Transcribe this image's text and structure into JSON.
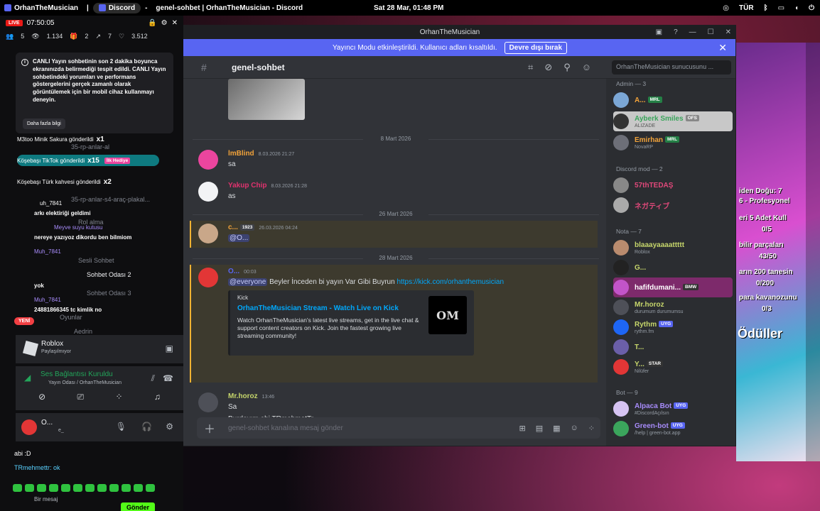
{
  "os": {
    "app1": "OrhanTheMusician",
    "app2": "Discord",
    "window_title": "genel-sohbet | OrhanTheMusician - Discord",
    "datetime": "Sat 28 Mar, 01:48 PM",
    "lang": "TÜR"
  },
  "stream": {
    "live": "LIVE",
    "timer": "07:50:05",
    "stats": [
      "5",
      "1.134",
      "2",
      "7",
      "3.512"
    ],
    "warning": "CANLI Yayın sohbetinin son 2 dakika boyunca ekranınızda belirmediği tespit edildi. CANLI Yayın sohbetindeki yorumları ve performans göstergelerini gerçek zamanlı olarak görüntülemek için bir mobil cihaz kullanmayı deneyin.",
    "warning_more": "Daha fazla bilgi",
    "gifts": [
      {
        "text": "M3too Minik Sakura gönderildi",
        "count": "x1"
      },
      {
        "text": "Köşebaşı TikTok gönderildi",
        "count": "x15",
        "badge": "İlk Hediye"
      },
      {
        "text": "Köşebaşı Türk kahvesi gönderildi",
        "count": "x2"
      }
    ],
    "chat": [
      "uh_7841",
      "arkı elektiriği geldimi",
      "Meyve suyu kutusu",
      "nereye yazıyoz dikordu ben bilmiom",
      "Muh_7841",
      "yok",
      "Muh_7841",
      "24881866345 tc kimlik no"
    ],
    "bottom_chat": [
      "abi :D",
      "TRmehmettr: ok"
    ],
    "input_placeholder": "Bir mesaj",
    "send": "Gönder",
    "new_badge": "YENİ"
  },
  "sidebar": {
    "channels": [
      "35-rp-anlar-al",
      "35-rp-anlar-s4-araç-plakal...",
      "Rol alma",
      "Sesli Sohbet",
      "Sohbet Odası 2",
      "Sohbet Odası 3",
      "Oyunlar",
      "Aedrin"
    ],
    "activity_name": "Roblox",
    "activity_sub": "Paylaşılmıyor",
    "voice_status": "Ses Bağlantısı Kuruldu",
    "voice_channel": "Yayın Odası / OrhanTheMusician",
    "user_name": "O...",
    "user_sub": "e_"
  },
  "discord": {
    "title": "OrhanTheMusician",
    "banner_text": "Yayıncı Modu etkinleştirildi. Kullanıcı adları kısaltıldı.",
    "banner_btn": "Devre dışı bırak",
    "channel": "genel-sohbet",
    "search_placeholder": "OrhanTheMusician sunucusunu ...",
    "composer_placeholder": "genel-sohbet kanalına mesaj gönder",
    "dates": [
      "8 Mart 2026",
      "26 Mart 2026",
      "28 Mart 2026"
    ],
    "messages": [
      {
        "author": "lmBlind",
        "ts": "8.03.2026 21:27",
        "text": "sa",
        "color": "#f2a33a"
      },
      {
        "author": "Yakup Chip",
        "ts": "8.03.2026 21:28",
        "text": "as",
        "color": "#e0326e"
      },
      {
        "author": "c...",
        "badge": "1923",
        "ts": "26.03.2026 04:24",
        "text": "@O...",
        "color": "#f2a33a"
      },
      {
        "author": "O...",
        "ts": "00:03",
        "mention": "@everyone",
        "text": "Beyler İnceden bi yayın Var Gibi Buyrun",
        "link": "https://kick.com/orhanthemusician",
        "color": "#5865f2"
      },
      {
        "author": "Mr.horoz",
        "ts": "13:46",
        "text": "Sa",
        "text2": "Burdayım abi TRmehmetTr",
        "color": "#c6d66b"
      }
    ],
    "embed": {
      "provider": "Kick",
      "title": "OrhanTheMusician Stream - Watch Live on Kick",
      "desc": "Watch OrhanTheMusician's latest live streams, get in the live chat & support content creators on Kick. Join the fastest growing live streaming community!",
      "thumb_text": "OM"
    }
  },
  "members": {
    "groups": [
      "Admin — 3",
      "Discord mod — 2",
      "Nota — 7",
      "Bot — 9"
    ],
    "list": [
      {
        "name": "A...",
        "tag": "MRL",
        "color": "#f2a33a"
      },
      {
        "name": "Ayberk Smiles",
        "tag": "OFS",
        "sub": "ALIZADE",
        "color": "#3ba55c"
      },
      {
        "name": "Emirhan",
        "tag": "MRL",
        "sub": "NovaRP",
        "color": "#f2a33a"
      },
      {
        "name": "57thTEDAŞ",
        "color": "#e0487a"
      },
      {
        "name": "ネガティブ",
        "color": "#e0487a"
      },
      {
        "name": "blaaayaaaattttt",
        "sub": "Roblox",
        "color": "#c6d66b"
      },
      {
        "name": "G...",
        "color": "#c6d66b"
      },
      {
        "name": "hafifdumani...",
        "tag": "BMW",
        "color": "#ffffff"
      },
      {
        "name": "Mr.horoz",
        "sub": "durumum durumumsu",
        "color": "#c6d66b"
      },
      {
        "name": "Rythm",
        "tag": "UYG",
        "sub": "rythm.fm",
        "color": "#c6d66b"
      },
      {
        "name": "T...",
        "color": "#c6d66b"
      },
      {
        "name": "Y...",
        "tag": "STAR",
        "sub": "Nilüfer",
        "color": "#c6d66b"
      },
      {
        "name": "Alpaca Bot",
        "tag": "UYG",
        "sub": "#DiscordAçılsın",
        "color": "#a78bfa"
      },
      {
        "name": "Green-bot",
        "tag": "UYG",
        "sub": "/help | green-bot.app",
        "color": "#a78bfa"
      }
    ]
  },
  "game": {
    "lines": [
      "iden Doğu: 7",
      "6 - Profesyonel",
      "eri 5 Adet Kull",
      "0/5",
      "bilir parçaları",
      "43/50",
      "arın 200 tanesin",
      "0/200",
      "para kavanozunu",
      "0/3",
      "Ödüller"
    ]
  }
}
